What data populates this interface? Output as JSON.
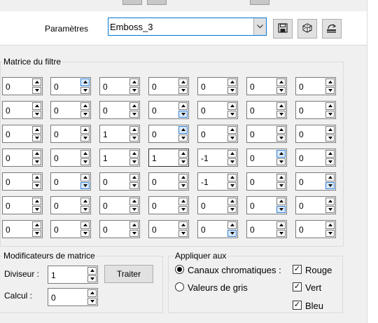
{
  "parameters": {
    "label": "Paramètres",
    "selected": "Emboss_3",
    "icons": [
      "save-icon",
      "dice-icon",
      "reset-icon"
    ]
  },
  "matrix": {
    "title": "Matrice du filtre",
    "rows": [
      [
        "0",
        "0",
        "0",
        "0",
        "0",
        "0",
        "0"
      ],
      [
        "0",
        "0",
        "0",
        "0",
        "0",
        "0",
        "0"
      ],
      [
        "0",
        "0",
        "1",
        "0",
        "0",
        "0",
        "0"
      ],
      [
        "0",
        "0",
        "1",
        "1",
        "-1",
        "0",
        "0"
      ],
      [
        "0",
        "0",
        "0",
        "0",
        "-1",
        "0",
        "0"
      ],
      [
        "0",
        "0",
        "0",
        "0",
        "0",
        "0",
        "0"
      ],
      [
        "0",
        "0",
        "0",
        "0",
        "0",
        "0",
        "0"
      ]
    ]
  },
  "modifiers": {
    "title": "Modificateurs de matrice",
    "divisor_label": "Diviseur :",
    "divisor_value": "1",
    "calc_label": "Calcul :",
    "calc_value": "0",
    "apply_button": "Traiter"
  },
  "apply": {
    "title": "Appliquer aux",
    "radio_color": "Canaux chromatiques :",
    "radio_gray": "Valeurs de gris",
    "check_red": "Rouge",
    "check_green": "Vert",
    "check_blue": "Bleu",
    "color_selected": true,
    "red_checked": true,
    "green_checked": true,
    "blue_checked": true
  }
}
